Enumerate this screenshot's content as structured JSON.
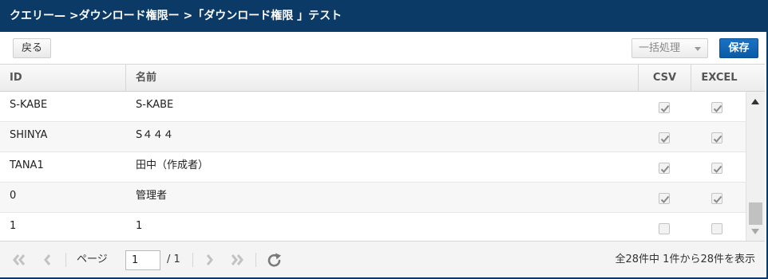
{
  "title": "クエリー— >ダウンロード権限ー >「ダウンロード権限 」テスト",
  "toolbar": {
    "back_label": "戻る",
    "batch_label": "一括処理",
    "save_label": "保存"
  },
  "columns": {
    "id": "ID",
    "name": "名前",
    "csv": "CSV",
    "excel": "EXCEL"
  },
  "rows": [
    {
      "id": "S-KABE",
      "name": "S-KABE",
      "csv": true,
      "excel": true
    },
    {
      "id": "SHINYA",
      "name": "S４４４",
      "csv": true,
      "excel": true
    },
    {
      "id": "TANA1",
      "name": "田中（作成者）",
      "csv": true,
      "excel": true
    },
    {
      "id": "0",
      "name": "管理者",
      "csv": true,
      "excel": true
    },
    {
      "id": "1",
      "name": "1",
      "csv": false,
      "excel": false
    }
  ],
  "pager": {
    "page_label": "ページ",
    "page_value": "1",
    "total_pages": "/ 1",
    "info": "全28件中 1件から28件を表示"
  },
  "icons": {
    "first": "first-page-icon",
    "prev": "prev-page-icon",
    "next": "next-page-icon",
    "last": "last-page-icon",
    "refresh": "refresh-icon"
  },
  "colors": {
    "titlebar": "#0b3a67",
    "save_button": "#0b5aa6"
  }
}
